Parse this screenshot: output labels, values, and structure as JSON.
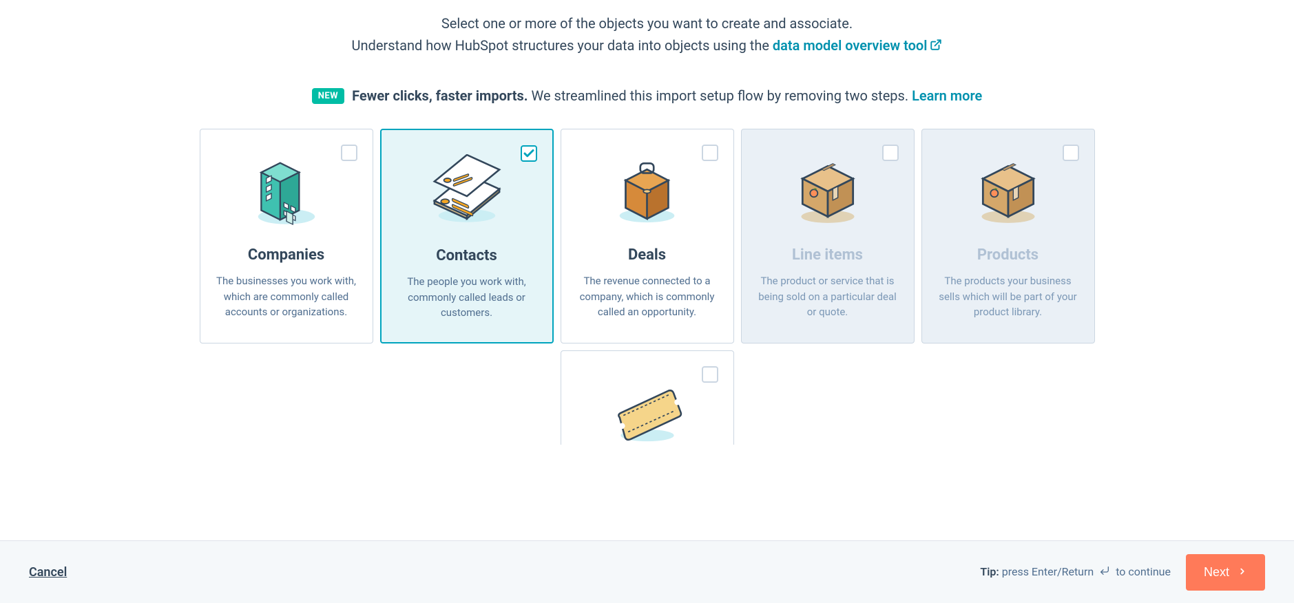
{
  "instructions": {
    "line1": "Select one or more of the objects you want to create and associate.",
    "line2_prefix": "Understand how HubSpot structures your data into objects using the ",
    "line2_link": "data model overview tool"
  },
  "promo": {
    "badge": "NEW",
    "bold": "Fewer clicks, faster imports.",
    "text": " We streamlined this import setup flow by removing two steps. ",
    "learn_more": "Learn more"
  },
  "cards": {
    "companies": {
      "title": "Companies",
      "desc": "The businesses you work with, which are commonly called accounts or organizations."
    },
    "contacts": {
      "title": "Contacts",
      "desc": "The people you work with, commonly called leads or customers."
    },
    "deals": {
      "title": "Deals",
      "desc": "The revenue connected to a company, which is commonly called an opportunity."
    },
    "lineitems": {
      "title": "Line items",
      "desc": "The product or service that is being sold on a particular deal or quote."
    },
    "products": {
      "title": "Products",
      "desc": "The products your business sells which will be part of your product library."
    }
  },
  "footer": {
    "cancel": "Cancel",
    "tip_label": "Tip:",
    "tip_text_before": " press Enter/Return ",
    "tip_text_after": " to continue",
    "next": "Next"
  }
}
